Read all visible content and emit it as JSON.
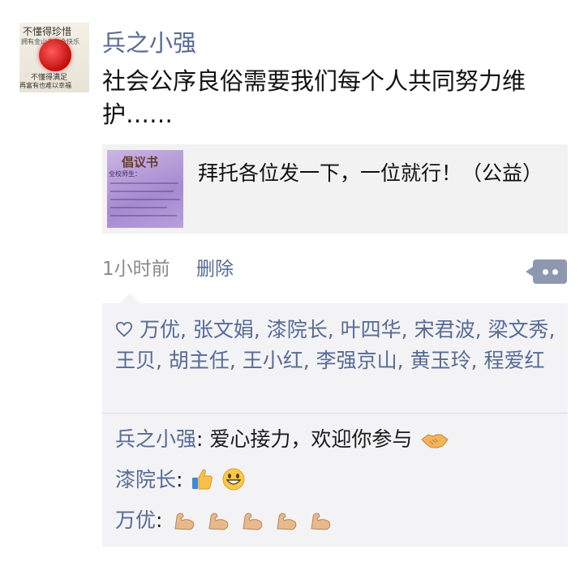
{
  "post": {
    "author": "兵之小强",
    "text": "社会公序良俗需要我们每个人共同努力维护……",
    "avatar": {
      "top_text": "不懂得珍惜",
      "mid_text": "拥有金山未必会快乐",
      "bottom_text_1": "不懂得满足",
      "bottom_text_2": "再富有也难以幸福"
    },
    "share": {
      "title": "拜托各位发一下，一位就行！（公益）",
      "thumb_title": "倡议书",
      "thumb_sub": "全校师生："
    },
    "time": "1小时前",
    "delete_label": "删除"
  },
  "likes": {
    "names": "万优, 张文娟, 漆院长, 叶四华, 宋君波, 梁文秀, 王贝, 胡主任, 王小红, 李强京山, 黄玉玲, 程爱红"
  },
  "comments": [
    {
      "name": "兵之小强",
      "text": "爱心接力，欢迎你参与",
      "emoji": [
        "handshake"
      ]
    },
    {
      "name": "漆院长",
      "text": "",
      "emoji": [
        "thumbs-up",
        "grinning-face"
      ]
    },
    {
      "name": "万优",
      "text": "",
      "emoji": [
        "flexed-biceps",
        "flexed-biceps",
        "flexed-biceps",
        "flexed-biceps",
        "flexed-biceps"
      ]
    }
  ],
  "colors": {
    "link": "#576b95",
    "comment_bg": "#f3f3f5",
    "card_bg": "#f2f2f2",
    "meta_gray": "#8a8a8a"
  }
}
